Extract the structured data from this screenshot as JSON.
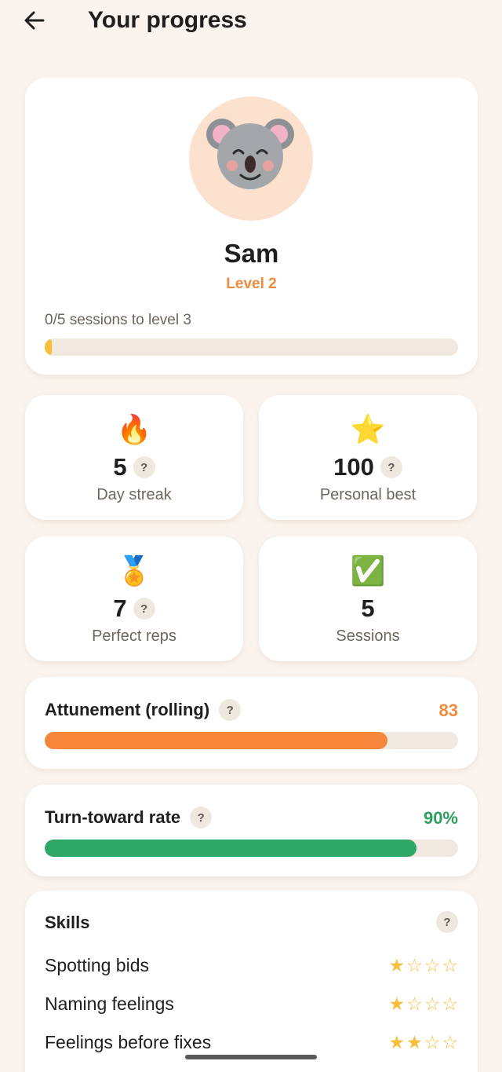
{
  "header": {
    "title": "Your progress"
  },
  "profile": {
    "name": "Sam",
    "level_label": "Level 2",
    "progress_text": "0/5 sessions to level 3",
    "progress_fraction": 0.0
  },
  "stats": [
    {
      "emoji": "🔥",
      "value": "5",
      "label": "Day streak",
      "has_help": true
    },
    {
      "emoji": "⭐",
      "value": "100",
      "label": "Personal best",
      "has_help": true
    },
    {
      "emoji": "🏅",
      "value": "7",
      "label": "Perfect reps",
      "has_help": true
    },
    {
      "emoji": "✅",
      "value": "5",
      "label": "Sessions",
      "has_help": false
    }
  ],
  "attunement": {
    "label": "Attunement (rolling)",
    "value": "83",
    "fraction": 0.83,
    "color": "#f08a3c",
    "bar_color": "#f5863a"
  },
  "turn_toward": {
    "label": "Turn-toward rate",
    "value": "90%",
    "fraction": 0.9,
    "color": "#2e9e5e",
    "bar_color": "#2ea865"
  },
  "skills": {
    "title": "Skills",
    "items": [
      {
        "name": "Spotting bids",
        "stars": 1,
        "max": 4
      },
      {
        "name": "Naming feelings",
        "stars": 1,
        "max": 4
      },
      {
        "name": "Feelings before fixes",
        "stars": 2,
        "max": 4
      }
    ]
  },
  "help_glyph": "?",
  "colors": {
    "background": "#fbf4ee",
    "accent_orange": "#f08a3c",
    "accent_green": "#2e9e5e",
    "star": "#f7bd3b"
  }
}
